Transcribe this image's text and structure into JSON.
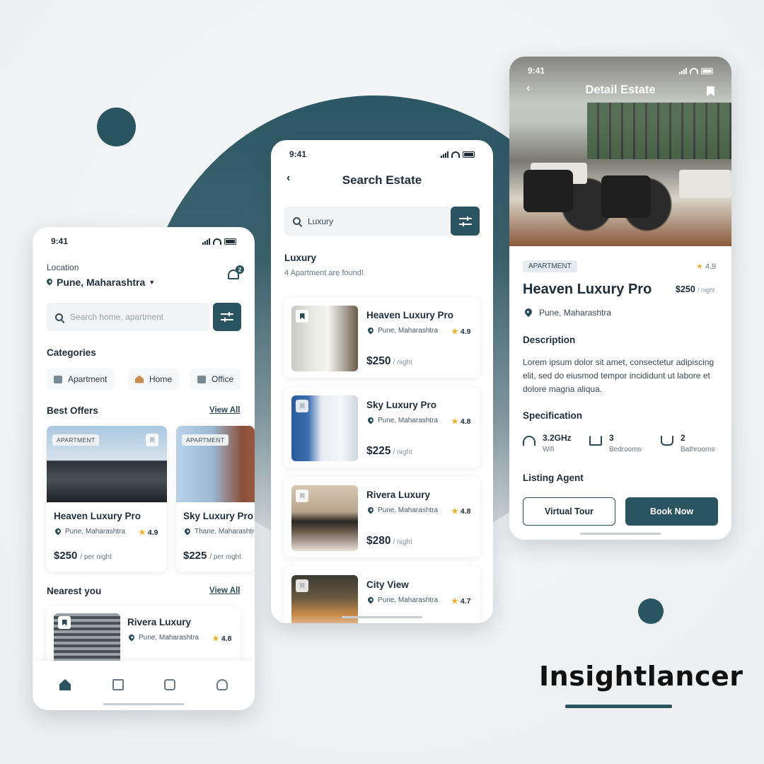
{
  "colors": {
    "accent": "#2b5461",
    "star": "#f2b134",
    "background": "#f2f3f4"
  },
  "brand": "Insightlancer",
  "home_screen": {
    "time": "9:41",
    "location_label": "Location",
    "location_value": "Pune, Maharashtra",
    "notification_count": "2",
    "search_placeholder": "Search home, apartment",
    "categories_title": "Categories",
    "categories": [
      {
        "label": "Apartment",
        "icon": "building-icon"
      },
      {
        "label": "Home",
        "icon": "house-icon"
      },
      {
        "label": "Office",
        "icon": "office-icon"
      }
    ],
    "best_offers_title": "Best Offers",
    "view_all": "View All",
    "offers": [
      {
        "tag": "APARTMENT",
        "name": "Heaven Luxury Pro",
        "location": "Pune, Maharashtra",
        "rating": "4.9",
        "price": "$250",
        "unit": "/ per night"
      },
      {
        "tag": "APARTMENT",
        "name": "Sky Luxury Pro",
        "location": "Thane, Maharashtra",
        "rating": "",
        "price": "$225",
        "unit": "/ per night"
      }
    ],
    "nearest_title": "Nearest you",
    "nearest": {
      "name": "Rivera Luxury",
      "location": "Pune, Maharashtra",
      "rating": "4.8"
    },
    "tabs": [
      "home-icon",
      "bookmark-icon",
      "mail-icon",
      "profile-icon"
    ]
  },
  "search_screen": {
    "time": "9:41",
    "title": "Search Estate",
    "query": "Luxury",
    "results_title": "Luxury",
    "results_count": "4 Apartment are found!",
    "results": [
      {
        "name": "Heaven Luxury Pro",
        "location": "Pune, Maharashtra",
        "rating": "4.9",
        "price": "$250",
        "unit": "/ night"
      },
      {
        "name": "Sky Luxury Pro",
        "location": "Pune, Maharashtra",
        "rating": "4.8",
        "price": "$225",
        "unit": "/ night"
      },
      {
        "name": "Rivera Luxury",
        "location": "Pune, Maharashtra",
        "rating": "4.8",
        "price": "$280",
        "unit": "/ night"
      },
      {
        "name": "City View",
        "location": "Pune, Maharashtra",
        "rating": "4.7",
        "price": "",
        "unit": ""
      }
    ]
  },
  "detail_screen": {
    "time": "9:41",
    "title": "Detail Estate",
    "tag": "APARTMENT",
    "rating": "4.9",
    "name": "Heaven Luxury Pro",
    "price": "$250",
    "unit": "/ night",
    "location": "Pune, Maharashtra",
    "description_title": "Description",
    "description": "Lorem ipsum dolor sit amet, consectetur adipiscing elit, sed do eiusmod tempor incididunt ut labore et dolore magna aliqua.",
    "specification_title": "Specification",
    "specs": [
      {
        "value": "3.2GHz",
        "label": "Wifi",
        "icon": "wifi-icon"
      },
      {
        "value": "3",
        "label": "Bedrooms",
        "icon": "bed-icon"
      },
      {
        "value": "2",
        "label": "Bathrooms",
        "icon": "bathtub-icon"
      }
    ],
    "listing_agent_title": "Listing Agent",
    "virtual_tour": "Virtual Tour",
    "book_now": "Book Now"
  }
}
